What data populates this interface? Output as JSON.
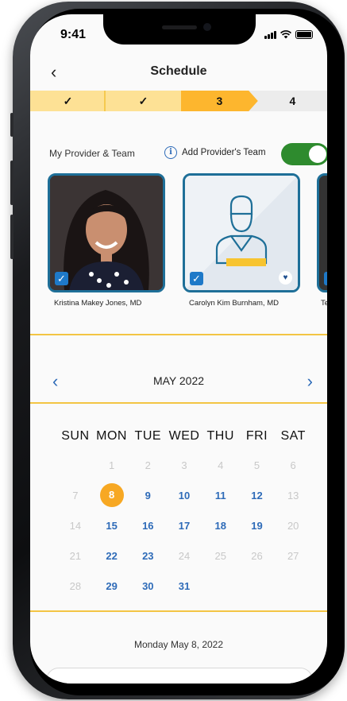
{
  "status": {
    "time": "9:41"
  },
  "header": {
    "title": "Schedule",
    "back_icon": "chevron-left-icon"
  },
  "stepper": {
    "steps": [
      "✓",
      "✓",
      "3",
      "4"
    ],
    "current": 3
  },
  "providers": {
    "section_label": "My Provider & Team",
    "add_team_label": "Add Provider's Team",
    "toggle_on": true,
    "cards": [
      {
        "name": "Kristina Makey Jones, MD",
        "selected": true
      },
      {
        "name": "Carolyn Kim Burnham, MD",
        "selected": true,
        "favorite": true
      },
      {
        "name": "Ter",
        "selected": true
      }
    ]
  },
  "calendar": {
    "month": "MAY 2022",
    "weekdays": [
      "SUN",
      "MON",
      "TUE",
      "WED",
      "THU",
      "FRI",
      "SAT"
    ],
    "weeks": [
      [
        "",
        "1",
        "2",
        "3",
        "4",
        "5",
        "6"
      ],
      [
        "7",
        "8",
        "9",
        "10",
        "11",
        "12",
        "13"
      ],
      [
        "14",
        "15",
        "16",
        "17",
        "18",
        "19",
        "20"
      ],
      [
        "21",
        "22",
        "23",
        "24",
        "25",
        "26",
        "27"
      ],
      [
        "28",
        "29",
        "30",
        "31",
        "",
        "",
        ""
      ]
    ],
    "available": [
      "8",
      "9",
      "10",
      "11",
      "12",
      "15",
      "16",
      "17",
      "18",
      "19",
      "22",
      "23",
      "29",
      "30",
      "31"
    ],
    "selected": "8"
  },
  "selected_date_label": "Monday May 8, 2022",
  "colors": {
    "accent_yellow": "#fdb62e",
    "link_blue": "#2e6bb8",
    "toggle_green": "#2e8b2e",
    "card_border": "#1e6f98"
  }
}
